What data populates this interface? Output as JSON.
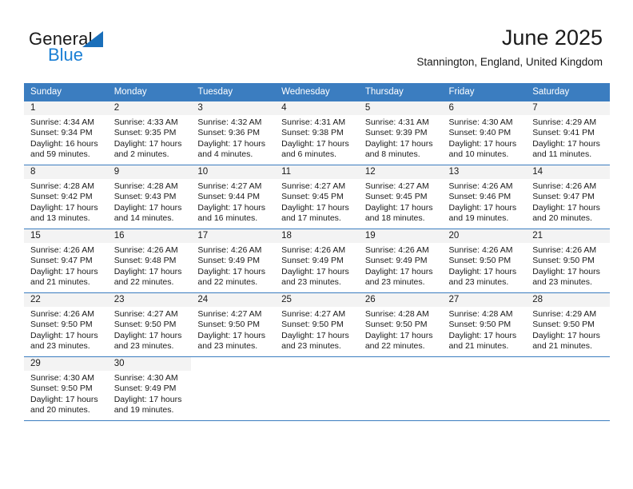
{
  "brand": {
    "name_part1": "General",
    "name_part2": "Blue",
    "triangle_color": "#1a6fba",
    "blue_color": "#1a7fd4"
  },
  "header": {
    "month_title": "June 2025",
    "location": "Stannington, England, United Kingdom"
  },
  "theme": {
    "header_bg": "#3b7dc0",
    "header_text": "#ffffff",
    "daynum_band": "#f3f3f3",
    "grid_line": "#3b7dc0",
    "page_bg": "#ffffff"
  },
  "weekday_headers": [
    "Sunday",
    "Monday",
    "Tuesday",
    "Wednesday",
    "Thursday",
    "Friday",
    "Saturday"
  ],
  "weeks": [
    [
      {
        "day": "1",
        "sunrise": "Sunrise: 4:34 AM",
        "sunset": "Sunset: 9:34 PM",
        "daylight1": "Daylight: 16 hours",
        "daylight2": "and 59 minutes."
      },
      {
        "day": "2",
        "sunrise": "Sunrise: 4:33 AM",
        "sunset": "Sunset: 9:35 PM",
        "daylight1": "Daylight: 17 hours",
        "daylight2": "and 2 minutes."
      },
      {
        "day": "3",
        "sunrise": "Sunrise: 4:32 AM",
        "sunset": "Sunset: 9:36 PM",
        "daylight1": "Daylight: 17 hours",
        "daylight2": "and 4 minutes."
      },
      {
        "day": "4",
        "sunrise": "Sunrise: 4:31 AM",
        "sunset": "Sunset: 9:38 PM",
        "daylight1": "Daylight: 17 hours",
        "daylight2": "and 6 minutes."
      },
      {
        "day": "5",
        "sunrise": "Sunrise: 4:31 AM",
        "sunset": "Sunset: 9:39 PM",
        "daylight1": "Daylight: 17 hours",
        "daylight2": "and 8 minutes."
      },
      {
        "day": "6",
        "sunrise": "Sunrise: 4:30 AM",
        "sunset": "Sunset: 9:40 PM",
        "daylight1": "Daylight: 17 hours",
        "daylight2": "and 10 minutes."
      },
      {
        "day": "7",
        "sunrise": "Sunrise: 4:29 AM",
        "sunset": "Sunset: 9:41 PM",
        "daylight1": "Daylight: 17 hours",
        "daylight2": "and 11 minutes."
      }
    ],
    [
      {
        "day": "8",
        "sunrise": "Sunrise: 4:28 AM",
        "sunset": "Sunset: 9:42 PM",
        "daylight1": "Daylight: 17 hours",
        "daylight2": "and 13 minutes."
      },
      {
        "day": "9",
        "sunrise": "Sunrise: 4:28 AM",
        "sunset": "Sunset: 9:43 PM",
        "daylight1": "Daylight: 17 hours",
        "daylight2": "and 14 minutes."
      },
      {
        "day": "10",
        "sunrise": "Sunrise: 4:27 AM",
        "sunset": "Sunset: 9:44 PM",
        "daylight1": "Daylight: 17 hours",
        "daylight2": "and 16 minutes."
      },
      {
        "day": "11",
        "sunrise": "Sunrise: 4:27 AM",
        "sunset": "Sunset: 9:45 PM",
        "daylight1": "Daylight: 17 hours",
        "daylight2": "and 17 minutes."
      },
      {
        "day": "12",
        "sunrise": "Sunrise: 4:27 AM",
        "sunset": "Sunset: 9:45 PM",
        "daylight1": "Daylight: 17 hours",
        "daylight2": "and 18 minutes."
      },
      {
        "day": "13",
        "sunrise": "Sunrise: 4:26 AM",
        "sunset": "Sunset: 9:46 PM",
        "daylight1": "Daylight: 17 hours",
        "daylight2": "and 19 minutes."
      },
      {
        "day": "14",
        "sunrise": "Sunrise: 4:26 AM",
        "sunset": "Sunset: 9:47 PM",
        "daylight1": "Daylight: 17 hours",
        "daylight2": "and 20 minutes."
      }
    ],
    [
      {
        "day": "15",
        "sunrise": "Sunrise: 4:26 AM",
        "sunset": "Sunset: 9:47 PM",
        "daylight1": "Daylight: 17 hours",
        "daylight2": "and 21 minutes."
      },
      {
        "day": "16",
        "sunrise": "Sunrise: 4:26 AM",
        "sunset": "Sunset: 9:48 PM",
        "daylight1": "Daylight: 17 hours",
        "daylight2": "and 22 minutes."
      },
      {
        "day": "17",
        "sunrise": "Sunrise: 4:26 AM",
        "sunset": "Sunset: 9:49 PM",
        "daylight1": "Daylight: 17 hours",
        "daylight2": "and 22 minutes."
      },
      {
        "day": "18",
        "sunrise": "Sunrise: 4:26 AM",
        "sunset": "Sunset: 9:49 PM",
        "daylight1": "Daylight: 17 hours",
        "daylight2": "and 23 minutes."
      },
      {
        "day": "19",
        "sunrise": "Sunrise: 4:26 AM",
        "sunset": "Sunset: 9:49 PM",
        "daylight1": "Daylight: 17 hours",
        "daylight2": "and 23 minutes."
      },
      {
        "day": "20",
        "sunrise": "Sunrise: 4:26 AM",
        "sunset": "Sunset: 9:50 PM",
        "daylight1": "Daylight: 17 hours",
        "daylight2": "and 23 minutes."
      },
      {
        "day": "21",
        "sunrise": "Sunrise: 4:26 AM",
        "sunset": "Sunset: 9:50 PM",
        "daylight1": "Daylight: 17 hours",
        "daylight2": "and 23 minutes."
      }
    ],
    [
      {
        "day": "22",
        "sunrise": "Sunrise: 4:26 AM",
        "sunset": "Sunset: 9:50 PM",
        "daylight1": "Daylight: 17 hours",
        "daylight2": "and 23 minutes."
      },
      {
        "day": "23",
        "sunrise": "Sunrise: 4:27 AM",
        "sunset": "Sunset: 9:50 PM",
        "daylight1": "Daylight: 17 hours",
        "daylight2": "and 23 minutes."
      },
      {
        "day": "24",
        "sunrise": "Sunrise: 4:27 AM",
        "sunset": "Sunset: 9:50 PM",
        "daylight1": "Daylight: 17 hours",
        "daylight2": "and 23 minutes."
      },
      {
        "day": "25",
        "sunrise": "Sunrise: 4:27 AM",
        "sunset": "Sunset: 9:50 PM",
        "daylight1": "Daylight: 17 hours",
        "daylight2": "and 23 minutes."
      },
      {
        "day": "26",
        "sunrise": "Sunrise: 4:28 AM",
        "sunset": "Sunset: 9:50 PM",
        "daylight1": "Daylight: 17 hours",
        "daylight2": "and 22 minutes."
      },
      {
        "day": "27",
        "sunrise": "Sunrise: 4:28 AM",
        "sunset": "Sunset: 9:50 PM",
        "daylight1": "Daylight: 17 hours",
        "daylight2": "and 21 minutes."
      },
      {
        "day": "28",
        "sunrise": "Sunrise: 4:29 AM",
        "sunset": "Sunset: 9:50 PM",
        "daylight1": "Daylight: 17 hours",
        "daylight2": "and 21 minutes."
      }
    ],
    [
      {
        "day": "29",
        "sunrise": "Sunrise: 4:30 AM",
        "sunset": "Sunset: 9:50 PM",
        "daylight1": "Daylight: 17 hours",
        "daylight2": "and 20 minutes."
      },
      {
        "day": "30",
        "sunrise": "Sunrise: 4:30 AM",
        "sunset": "Sunset: 9:49 PM",
        "daylight1": "Daylight: 17 hours",
        "daylight2": "and 19 minutes."
      },
      {
        "day": "",
        "sunrise": "",
        "sunset": "",
        "daylight1": "",
        "daylight2": ""
      },
      {
        "day": "",
        "sunrise": "",
        "sunset": "",
        "daylight1": "",
        "daylight2": ""
      },
      {
        "day": "",
        "sunrise": "",
        "sunset": "",
        "daylight1": "",
        "daylight2": ""
      },
      {
        "day": "",
        "sunrise": "",
        "sunset": "",
        "daylight1": "",
        "daylight2": ""
      },
      {
        "day": "",
        "sunrise": "",
        "sunset": "",
        "daylight1": "",
        "daylight2": ""
      }
    ]
  ]
}
